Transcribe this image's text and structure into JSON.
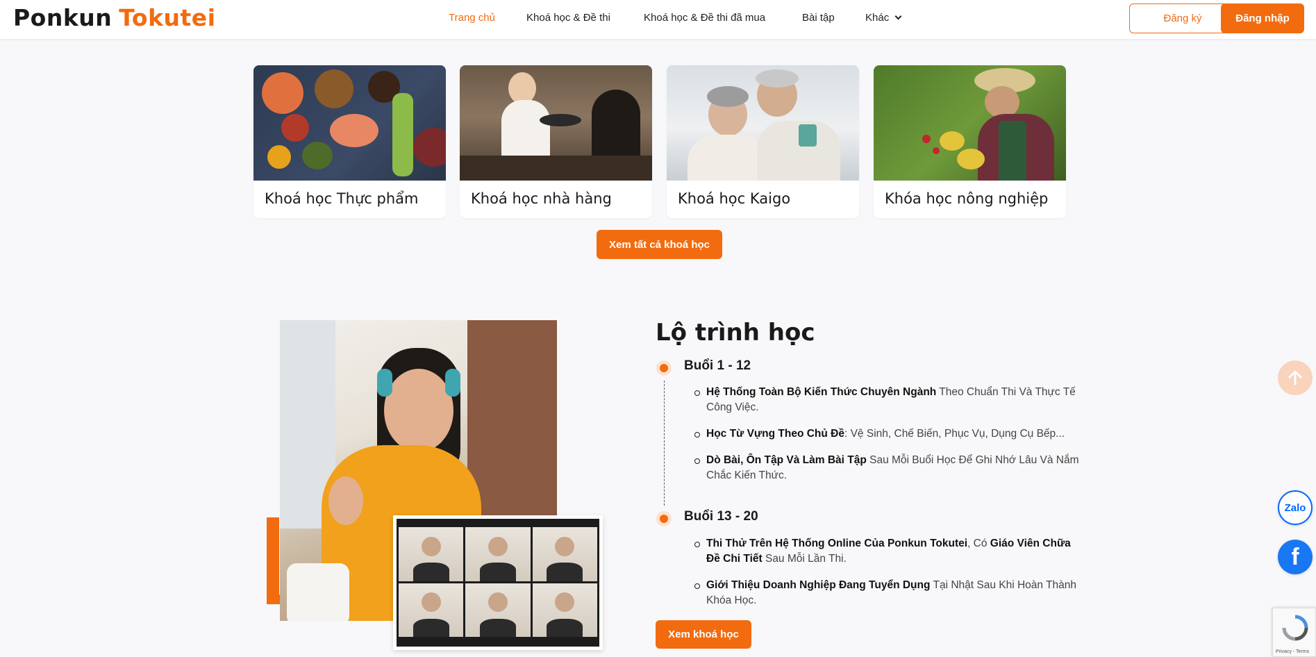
{
  "header": {
    "logo_part1": "Ponkun",
    "logo_part2": "Tokutei",
    "nav": [
      {
        "label": "Trang chủ"
      },
      {
        "label": "Khoá học & Đề thi"
      },
      {
        "label": "Khoá học & Đề thi đã mua"
      },
      {
        "label": "Bài tập"
      },
      {
        "label": "Khác"
      }
    ],
    "register_label": "Đăng ký",
    "login_label": "Đăng nhập"
  },
  "courses": [
    {
      "title": "Khoá học Thực phẩm"
    },
    {
      "title": "Khoá học nhà hàng"
    },
    {
      "title": "Khoá học Kaigo"
    },
    {
      "title": "Khóa học nông nghiệp"
    }
  ],
  "view_all_label": "Xem tất cả khoá học",
  "roadmap": {
    "title": "Lộ trình học",
    "stages": [
      {
        "name": "Buổi 1 - 12",
        "items": [
          {
            "bold": "Hệ Thống Toàn Bộ Kiến Thức Chuyên Ngành",
            "rest": " Theo Chuẩn Thi Và Thực Tế Công Việc."
          },
          {
            "bold": "Học Từ Vựng Theo Chủ Đề",
            "rest": ": Vệ Sinh, Chế Biến, Phục Vụ, Dụng Cụ Bếp..."
          },
          {
            "bold": "Dò Bài, Ôn Tập Và Làm Bài Tập",
            "rest": " Sau Mỗi Buổi Học Để Ghi Nhớ Lâu Và Nắm Chắc Kiến Thức."
          }
        ]
      },
      {
        "name": "Buổi 13 - 20",
        "items": [
          {
            "bold": "Thi Thử Trên Hệ Thống Online Của Ponkun Tokutei",
            "mid": ", Có ",
            "bold2": "Giáo Viên Chữa Đề Chi Tiết",
            "rest": " Sau Mỗi Lần Thi."
          },
          {
            "bold": "Giới Thiệu Doanh Nghiệp Đang Tuyển Dụng",
            "rest": " Tại Nhật Sau Khi Hoàn Thành Khóa Học."
          }
        ]
      }
    ],
    "button_label": "Xem khoá học"
  },
  "floating": {
    "zalo_label": "Zalo",
    "facebook_label": "f",
    "recaptcha_text": "Privacy - Terms"
  },
  "colors": {
    "accent": "#f26b0f",
    "zalo": "#0068ff",
    "facebook": "#1877f2"
  }
}
